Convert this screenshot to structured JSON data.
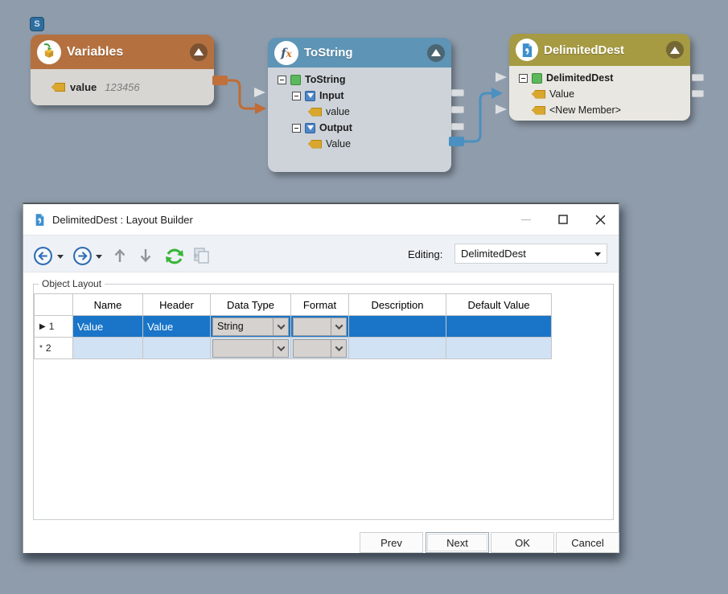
{
  "canvas": {
    "badge_label": "S",
    "variables": {
      "title": "Variables",
      "field_name": "value",
      "field_value": "123456"
    },
    "tostring": {
      "title": "ToString",
      "tree": [
        {
          "label": "ToString"
        },
        {
          "label": "Input"
        },
        {
          "label": "value"
        },
        {
          "label": "Output"
        },
        {
          "label": "Value"
        }
      ]
    },
    "delimiteddest": {
      "title": "DelimitedDest",
      "tree": [
        {
          "label": "DelimitedDest"
        },
        {
          "label": "Value"
        },
        {
          "label": "<New Member>"
        }
      ]
    }
  },
  "dialog": {
    "title": "DelimitedDest : Layout Builder",
    "toolbar": {
      "editing_label": "Editing:",
      "editing_value": "DelimitedDest"
    },
    "groupbox_label": "Object Layout",
    "table": {
      "columns": [
        "Name",
        "Header",
        "Data Type",
        "Format",
        "Description",
        "Default Value"
      ],
      "rows": [
        {
          "indicator": "▶",
          "num": "1",
          "name": "Value",
          "header": "Value",
          "data_type": "String",
          "format": "",
          "description": "",
          "default_value": ""
        },
        {
          "indicator": "*",
          "num": "2",
          "name": "",
          "header": "",
          "data_type": "",
          "format": "",
          "description": "",
          "default_value": ""
        }
      ]
    },
    "buttons": {
      "prev": "Prev",
      "next": "Next",
      "ok": "OK",
      "cancel": "Cancel"
    },
    "icons": {
      "back": "back-arrow",
      "forward": "forward-arrow",
      "move_up": "up-arrow",
      "move_down": "down-arrow",
      "refresh": "refresh-arrows",
      "paste": "paste-disabled",
      "minimize": "dash",
      "maximize": "square-outline",
      "close": "x"
    }
  },
  "colors": {
    "canvas_bg": "#8f9cab",
    "variables_header": "#b4713f",
    "tostring_header": "#5e94b5",
    "delimiteddest_header": "#a69a42",
    "selection_blue": "#1a75c8",
    "new_row_blue": "#d0e2f4",
    "wire_orange": "#c06c33",
    "wire_blue": "#4a90c0",
    "tag_gold": "#d9a62e",
    "element_green": "#5cb85c",
    "element_blue": "#4d87c7",
    "refresh_green": "#3cb53c",
    "nav_blue": "#2f6db0"
  }
}
